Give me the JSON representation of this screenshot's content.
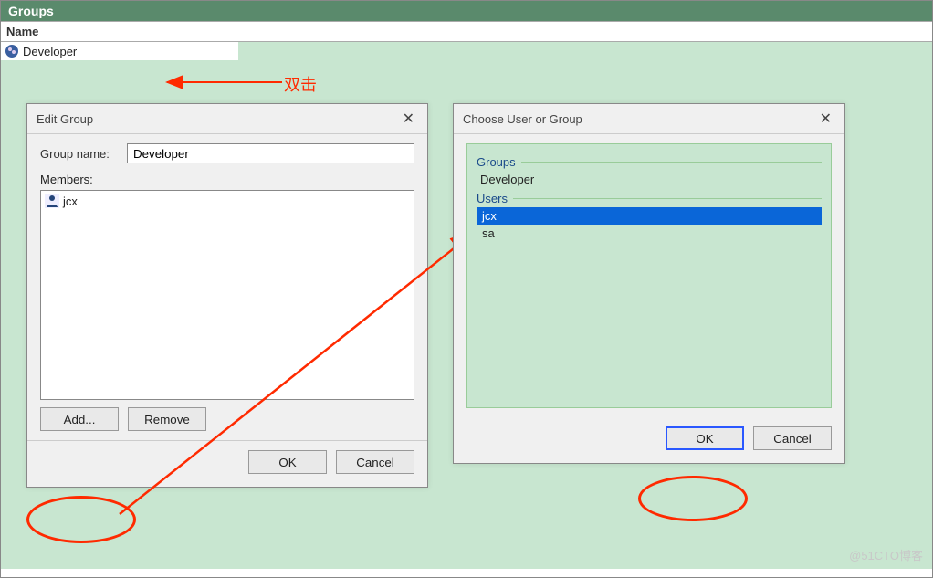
{
  "panel": {
    "title": "Groups",
    "column_header": "Name",
    "rows": [
      "Developer"
    ]
  },
  "annotation": {
    "double_click": "双击"
  },
  "edit_dialog": {
    "title": "Edit Group",
    "group_name_label": "Group name:",
    "group_name_value": "Developer",
    "members_label": "Members:",
    "members": [
      "jcx"
    ],
    "add_button": "Add...",
    "remove_button": "Remove",
    "ok_button": "OK",
    "cancel_button": "Cancel"
  },
  "choose_dialog": {
    "title": "Choose User or Group",
    "groups_legend": "Groups",
    "groups": [
      "Developer"
    ],
    "users_legend": "Users",
    "users": [
      "jcx",
      "sa"
    ],
    "selected_user": "jcx",
    "ok_button": "OK",
    "cancel_button": "Cancel"
  },
  "watermark": "@51CTO博客"
}
